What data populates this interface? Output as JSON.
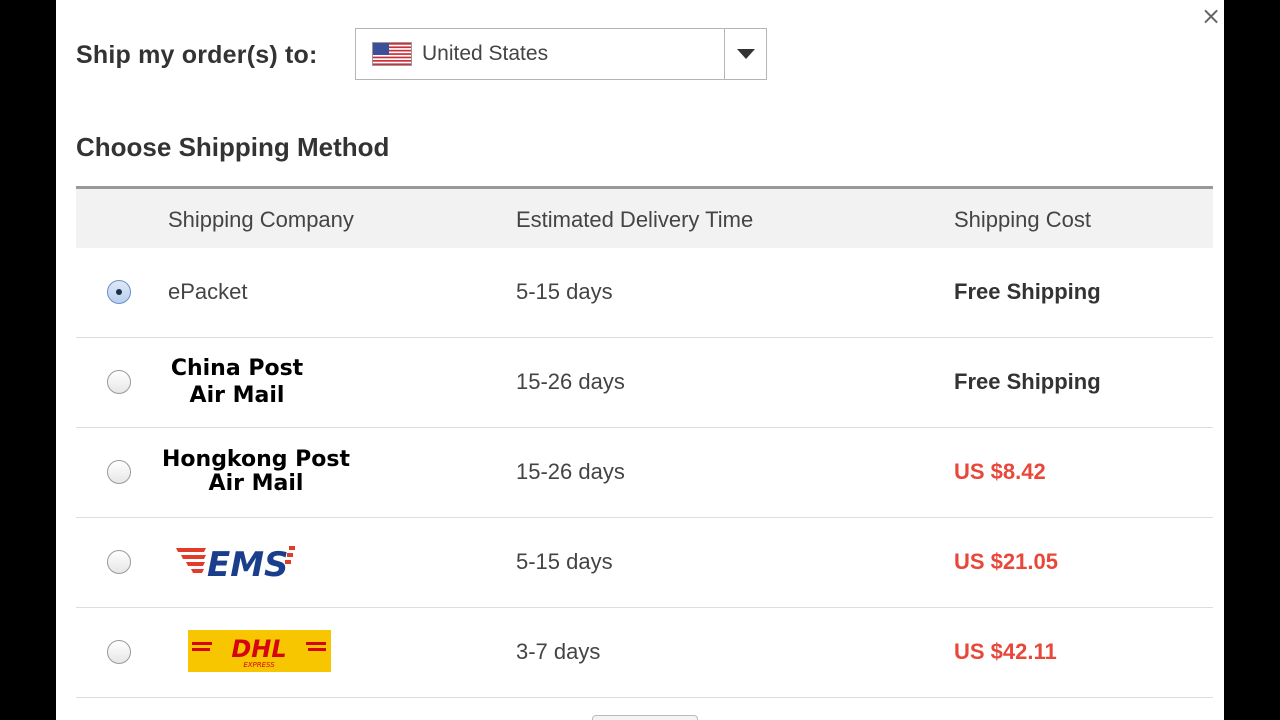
{
  "dialog": {
    "close_symbol": "×",
    "ship_to_label": "Ship my order(s) to:",
    "country": {
      "selected": "United States",
      "flag_icon": "us-flag-icon"
    },
    "section_title": "Choose Shipping Method"
  },
  "table": {
    "headers": {
      "company": "Shipping Company",
      "delivery": "Estimated Delivery Time",
      "cost": "Shipping Cost"
    },
    "rows": [
      {
        "company": "ePacket",
        "delivery": "5-15 days",
        "cost": "Free Shipping",
        "selected": true
      },
      {
        "company_line1": "China Post",
        "company_line2": "Air Mail",
        "delivery": "15-26 days",
        "cost": "Free Shipping",
        "selected": false
      },
      {
        "company_line1": "Hongkong Post",
        "company_line2": "Air Mail",
        "delivery": "15-26 days",
        "cost": "US $8.42",
        "selected": false
      },
      {
        "company_logo": "EMS",
        "delivery": "5-15 days",
        "cost": "US $21.05",
        "selected": false
      },
      {
        "company_logo": "DHL",
        "company_logo_sub": "EXPRESS",
        "delivery": "3-7 days",
        "cost": "US $42.11",
        "selected": false
      }
    ]
  },
  "colors": {
    "paid_cost": "#e8473a",
    "header_bg": "#f2f2f2",
    "dhl_yellow": "#f7c600",
    "dhl_red": "#d40511",
    "ems_blue": "#1a3e8c",
    "ems_red": "#e23b2a"
  }
}
